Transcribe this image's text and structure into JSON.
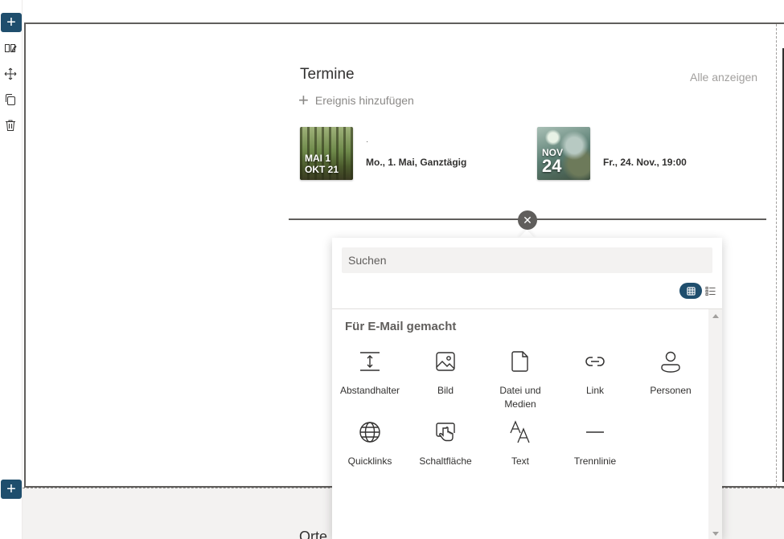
{
  "rail": {
    "add_top_label": "+",
    "add_bottom_label": "+",
    "tools": [
      "edit-properties-icon",
      "move-icon",
      "duplicate-icon",
      "delete-icon"
    ]
  },
  "events": {
    "title": "Termine",
    "see_all": "Alle anzeigen",
    "add_event": "Ereignis hinzufügen",
    "items": [
      {
        "thumb_line1": "MAI 1",
        "thumb_line2": "OKT 21",
        "dot": "·",
        "when": "Mo., 1. Mai, Ganztägig"
      },
      {
        "thumb_line1": "NOV",
        "thumb_line2": "24",
        "dot": "",
        "when": "Fr., 24. Nov., 19:00"
      }
    ]
  },
  "divider": {
    "close_label": "✕"
  },
  "toolbox": {
    "search_placeholder": "Suchen",
    "group_title": "Für E-Mail gemacht",
    "tools": [
      {
        "label": "Abstandhalter",
        "icon": "spacer-icon"
      },
      {
        "label": "Bild",
        "icon": "image-icon"
      },
      {
        "label": "Datei und Medien",
        "icon": "file-icon"
      },
      {
        "label": "Link",
        "icon": "link-icon"
      },
      {
        "label": "Personen",
        "icon": "person-icon"
      },
      {
        "label": "Quicklinks",
        "icon": "globe-icon"
      },
      {
        "label": "Schaltfläche",
        "icon": "button-icon"
      },
      {
        "label": "Text",
        "icon": "text-icon"
      },
      {
        "label": "Trennlinie",
        "icon": "divider-icon"
      }
    ]
  },
  "bottom_peek": "Orte",
  "colors": {
    "accent": "#1f4e6d",
    "border": "#605e5c",
    "muted": "#a19f9d"
  }
}
